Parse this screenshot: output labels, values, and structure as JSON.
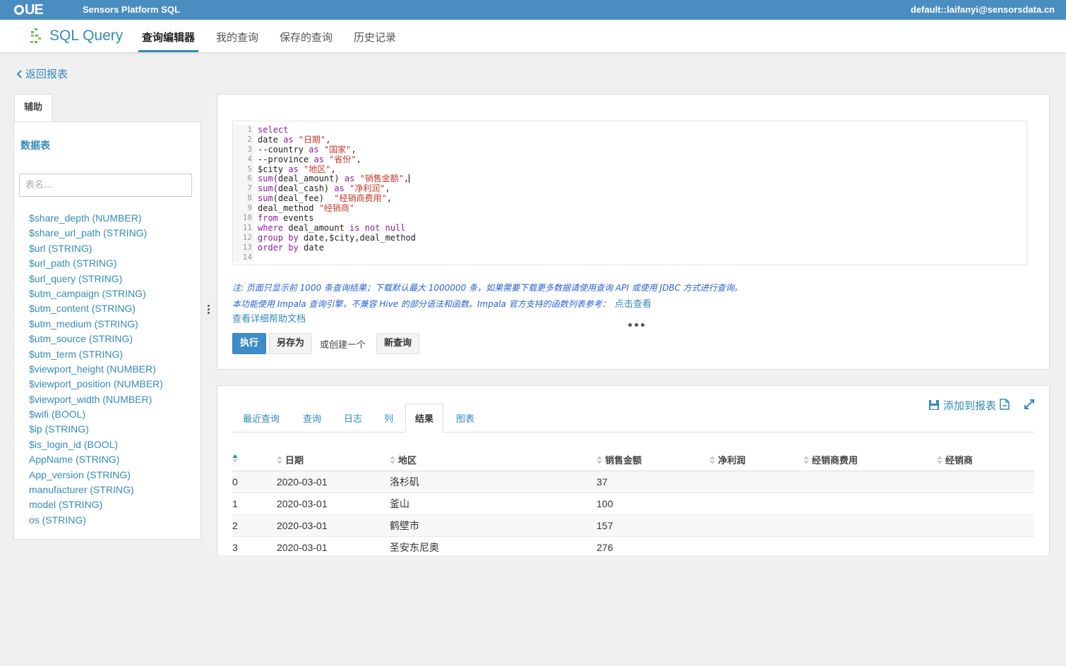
{
  "topbar": {
    "logo": "UE",
    "platform": "Sensors Platform SQL",
    "user": "default::laifanyi@sensorsdata.cn"
  },
  "nav": {
    "app_title": "SQL Query",
    "tabs": [
      "查询编辑器",
      "我的查询",
      "保存的查询",
      "历史记录"
    ],
    "active_tab": "查询编辑器"
  },
  "back": "返回报表",
  "assist": {
    "tab_label": "辅助",
    "db_label": "数据表",
    "search_placeholder": "表名...",
    "fields": [
      "$share_depth (NUMBER)",
      "$share_url_path (STRING)",
      "$url (STRING)",
      "$url_path (STRING)",
      "$url_query (STRING)",
      "$utm_campaign (STRING)",
      "$utm_content (STRING)",
      "$utm_medium (STRING)",
      "$utm_source (STRING)",
      "$utm_term (STRING)",
      "$viewport_height (NUMBER)",
      "$viewport_position (NUMBER)",
      "$viewport_width (NUMBER)",
      "$wifi (BOOL)",
      "$ip (STRING)",
      "$is_login_id (BOOL)",
      "AppName (STRING)",
      "App_version (STRING)",
      "manufacturer (STRING)",
      "model (STRING)",
      "os (STRING)"
    ]
  },
  "editor": {
    "line_numbers": [
      "1",
      "2",
      "3",
      "4",
      "5",
      "6",
      "7",
      "8",
      "9",
      "10",
      "11",
      "12",
      "13",
      "14"
    ],
    "lines": {
      "l1_kw": "select",
      "l2_a": "date ",
      "l2_kw": "as",
      "l2_str": " \"日期\"",
      "l2_b": ",",
      "l3_a": "--country ",
      "l3_kw": "as",
      "l3_str": " \"国家\"",
      "l3_b": ",",
      "l4_a": "--province ",
      "l4_kw": "as",
      "l4_str": " \"省份\"",
      "l4_b": ",",
      "l5_a": "$city ",
      "l5_kw": "as",
      "l5_str": " \"地区\"",
      "l5_b": ",",
      "l6_kw1": "sum",
      "l6_a": "(deal_amount) ",
      "l6_kw2": "as",
      "l6_str": " \"销售金额\"",
      "l6_b": ",",
      "l7_kw1": "sum",
      "l7_a": "(deal_cash) ",
      "l7_kw2": "as",
      "l7_str": " \"净利润\"",
      "l7_b": ",",
      "l8_kw1": "sum",
      "l8_a": "(deal_fee) ",
      "l8_str": " \"经销商费用\"",
      "l8_b": ",",
      "l9_a": "deal_method ",
      "l9_str": "\"经销商\"",
      "l10_kw": "from",
      "l10_a": " events",
      "l11_kw1": "where",
      "l11_a": " deal_amount ",
      "l11_kw2": "is not null",
      "l12_kw": "group by",
      "l12_a": " date,$city,deal_method",
      "l13_kw": "order by",
      "l13_a": " date"
    },
    "note1": "注: 页面只显示前 1000 条查询结果；下载默认最大 1000000 条，如果需要下载更多数据请使用查询 API 或使用 JDBC 方式进行查询。",
    "note2": "本功能使用 Impala 查询引擎，不兼容 Hive 的部分语法和函数。Impala 官方支持的函数列表参考：",
    "note2_link": "点击查看",
    "help_link": "查看详细帮助文档",
    "dots": "•••",
    "execute": "执行",
    "save_as": "另存为",
    "or_create": "或创建一个",
    "new_query": "新查询"
  },
  "results": {
    "tabs": [
      "最近查询",
      "查询",
      "日志",
      "列",
      "结果",
      "图表"
    ],
    "active_tab": "结果",
    "add_to_report": "添加到报表",
    "columns": [
      "",
      "日期",
      "地区",
      "销售金额",
      "净利润",
      "经销商费用",
      "经销商"
    ],
    "rows": [
      [
        "0",
        "2020-03-01",
        "洛杉矶",
        "37",
        "",
        "",
        ""
      ],
      [
        "1",
        "2020-03-01",
        "釜山",
        "100",
        "",
        "",
        ""
      ],
      [
        "2",
        "2020-03-01",
        "鹤壁市",
        "157",
        "",
        "",
        ""
      ],
      [
        "3",
        "2020-03-01",
        "圣安东尼奥",
        "276",
        "",
        "",
        ""
      ]
    ]
  },
  "colors": {
    "topbar": "#4a8ec1",
    "accent": "#338bb8",
    "exec_button": "#3d8dc9",
    "keyword": "#8e1ca8",
    "string": "#c0392b"
  }
}
